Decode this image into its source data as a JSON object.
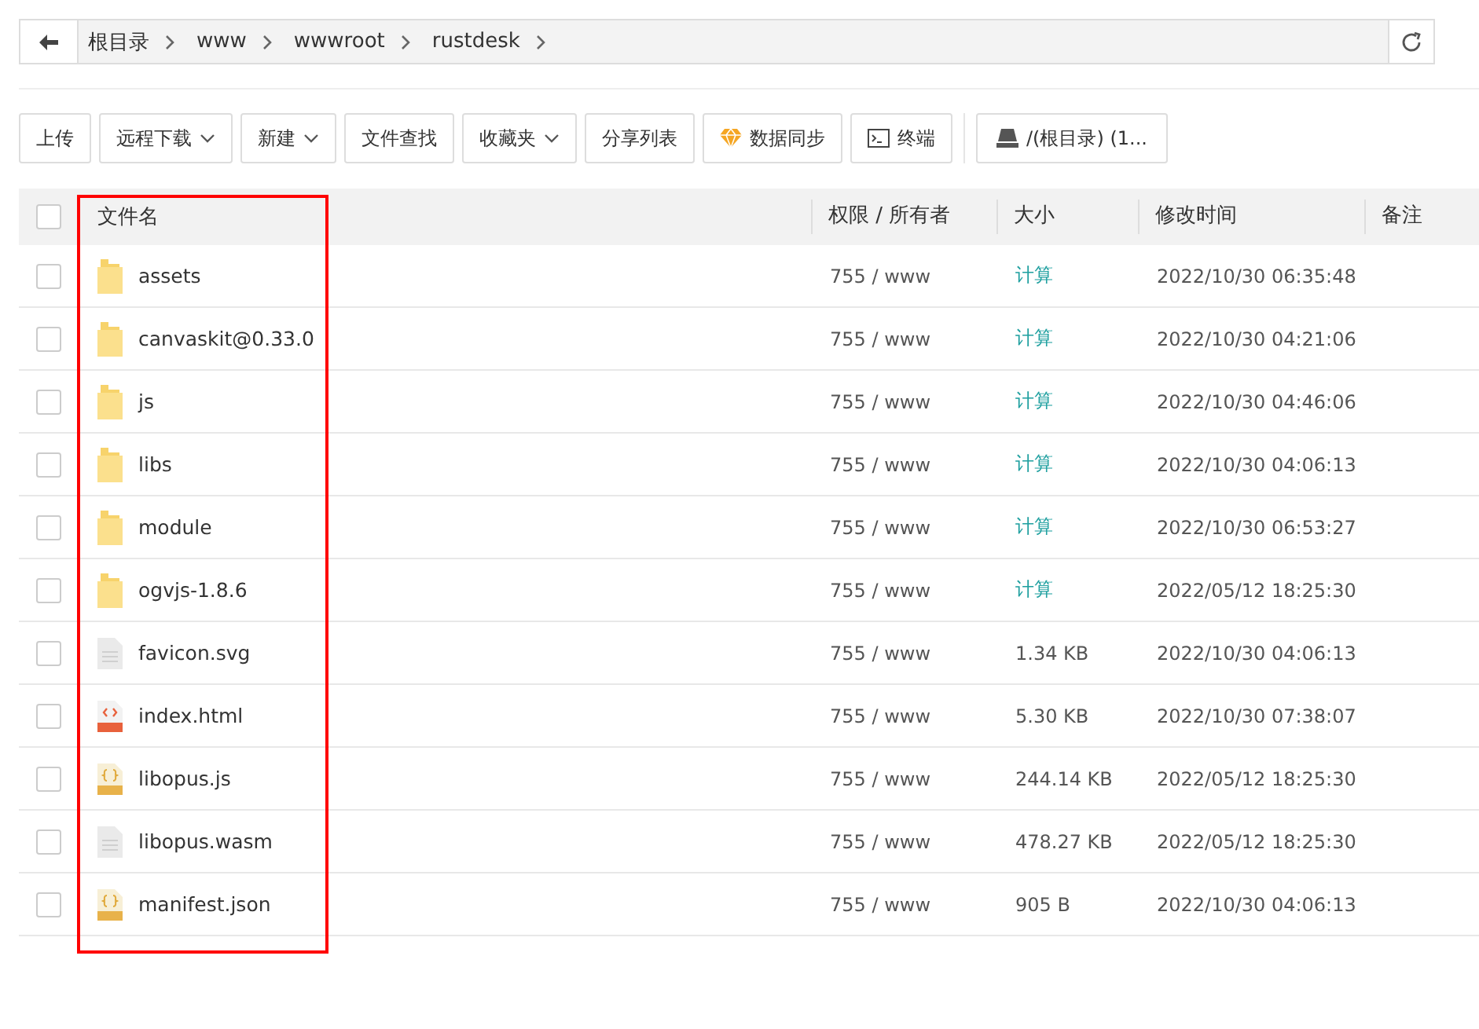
{
  "breadcrumb": [
    "根目录",
    "www",
    "wwwroot",
    "rustdesk"
  ],
  "toolbar": [
    {
      "label": "上传",
      "dropdown": false,
      "kind": "plain"
    },
    {
      "label": "远程下载",
      "dropdown": true,
      "kind": "plain"
    },
    {
      "label": "新建",
      "dropdown": true,
      "kind": "plain"
    },
    {
      "label": "文件查找",
      "dropdown": false,
      "kind": "plain"
    },
    {
      "label": "收藏夹",
      "dropdown": true,
      "kind": "plain"
    },
    {
      "label": "分享列表",
      "dropdown": false,
      "kind": "plain"
    },
    {
      "label": "数据同步",
      "dropdown": false,
      "kind": "gem"
    },
    {
      "label": "终端",
      "dropdown": false,
      "kind": "terminal"
    },
    {
      "label": "/(根目录) (1...",
      "dropdown": false,
      "kind": "disk"
    }
  ],
  "table": {
    "select_all_checked": false,
    "columns": [
      "文件名",
      "权限 / 所有者",
      "大小",
      "修改时间",
      "备注"
    ],
    "rows": [
      {
        "kind": "folder",
        "name": "assets",
        "perm": "755 / www",
        "size": "计算",
        "time": "2022/10/30 06:35:48",
        "checked": false
      },
      {
        "kind": "folder",
        "name": "canvaskit@0.33.0",
        "perm": "755 / www",
        "size": "计算",
        "time": "2022/10/30 04:21:06",
        "checked": false
      },
      {
        "kind": "folder",
        "name": "js",
        "perm": "755 / www",
        "size": "计算",
        "time": "2022/10/30 04:46:06",
        "checked": false
      },
      {
        "kind": "folder",
        "name": "libs",
        "perm": "755 / www",
        "size": "计算",
        "time": "2022/10/30 04:06:13",
        "checked": false
      },
      {
        "kind": "folder",
        "name": "module",
        "perm": "755 / www",
        "size": "计算",
        "time": "2022/10/30 06:53:27",
        "checked": false
      },
      {
        "kind": "folder",
        "name": "ogvjs-1.8.6",
        "perm": "755 / www",
        "size": "计算",
        "time": "2022/05/12 18:25:30",
        "checked": false
      },
      {
        "kind": "text",
        "name": "favicon.svg",
        "perm": "755 / www",
        "size": "1.34 KB",
        "time": "2022/10/30 04:06:13",
        "checked": false
      },
      {
        "kind": "html",
        "name": "index.html",
        "perm": "755 / www",
        "size": "5.30 KB",
        "time": "2022/10/30 07:38:07",
        "checked": false
      },
      {
        "kind": "js",
        "name": "libopus.js",
        "perm": "755 / www",
        "size": "244.14 KB",
        "time": "2022/05/12 18:25:30",
        "checked": false
      },
      {
        "kind": "text",
        "name": "libopus.wasm",
        "perm": "755 / www",
        "size": "478.27 KB",
        "time": "2022/05/12 18:25:30",
        "checked": false
      },
      {
        "kind": "json",
        "name": "manifest.json",
        "perm": "755 / www",
        "size": "905 B",
        "time": "2022/10/30 04:06:13",
        "checked": false
      }
    ]
  }
}
